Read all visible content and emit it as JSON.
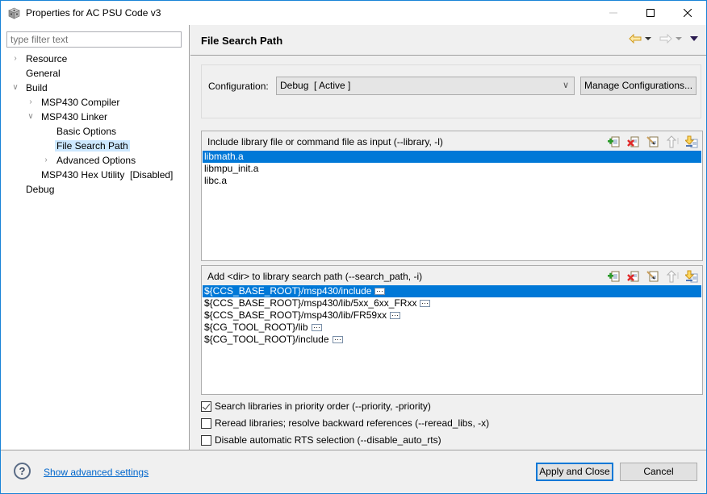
{
  "window": {
    "title": "Properties for AC PSU Code v3",
    "app_icon": "cube-icon",
    "controls": [
      "minimize",
      "maximize",
      "close"
    ]
  },
  "sidebar": {
    "filter_placeholder": "type filter text",
    "tree": [
      {
        "label": "Resource",
        "level": 0,
        "expander": "collapsed"
      },
      {
        "label": "General",
        "level": 0,
        "expander": "none"
      },
      {
        "label": "Build",
        "level": 0,
        "expander": "expanded"
      },
      {
        "label": "MSP430 Compiler",
        "level": 1,
        "expander": "collapsed"
      },
      {
        "label": "MSP430 Linker",
        "level": 1,
        "expander": "expanded"
      },
      {
        "label": "Basic Options",
        "level": 2,
        "expander": "none"
      },
      {
        "label": "File Search Path",
        "level": 2,
        "expander": "none",
        "selected": true
      },
      {
        "label": "Advanced Options",
        "level": 2,
        "expander": "collapsed"
      },
      {
        "label": "MSP430 Hex Utility  [Disabled]",
        "level": 1,
        "expander": "none"
      },
      {
        "label": "Debug",
        "level": 0,
        "expander": "none"
      }
    ]
  },
  "main": {
    "title": "File Search Path",
    "nav": {
      "back": "back-arrow-icon",
      "forward": "forward-arrow-icon",
      "menu": "view-menu-icon"
    },
    "configuration": {
      "label": "Configuration:",
      "selected": "Debug  [ Active ]",
      "manage_label": "Manage Configurations..."
    },
    "library_list": {
      "title": "Include library file or command file as input (--library, -l)",
      "tools": [
        "add",
        "delete",
        "edit",
        "move-up",
        "move-down"
      ],
      "items": [
        {
          "value": "libmath.a",
          "selected": true
        },
        {
          "value": "libmpu_init.a"
        },
        {
          "value": "libc.a"
        }
      ]
    },
    "search_path_list": {
      "title": "Add <dir> to library search path (--search_path, -i)",
      "tools": [
        "add",
        "delete",
        "edit",
        "move-up",
        "move-down"
      ],
      "items": [
        {
          "value": "${CCS_BASE_ROOT}/msp430/include",
          "selected": true
        },
        {
          "value": "${CCS_BASE_ROOT}/msp430/lib/5xx_6xx_FRxx"
        },
        {
          "value": "${CCS_BASE_ROOT}/msp430/lib/FR59xx"
        },
        {
          "value": "${CG_TOOL_ROOT}/lib"
        },
        {
          "value": "${CG_TOOL_ROOT}/include"
        }
      ]
    },
    "options": [
      {
        "label": "Search libraries in priority order (--priority, -priority)",
        "checked": true
      },
      {
        "label": "Reread libraries; resolve backward references (--reread_libs, -x)",
        "checked": false
      },
      {
        "label": "Disable automatic RTS selection (--disable_auto_rts)",
        "checked": false
      }
    ]
  },
  "footer": {
    "help_icon": "help-icon",
    "advanced_link": "Show advanced settings",
    "apply_label": "Apply and Close",
    "cancel_label": "Cancel"
  },
  "colors": {
    "selection": "#0078d7",
    "tree_selection": "#cce8ff",
    "window_border": "#1883d7",
    "link": "#0066cc"
  }
}
